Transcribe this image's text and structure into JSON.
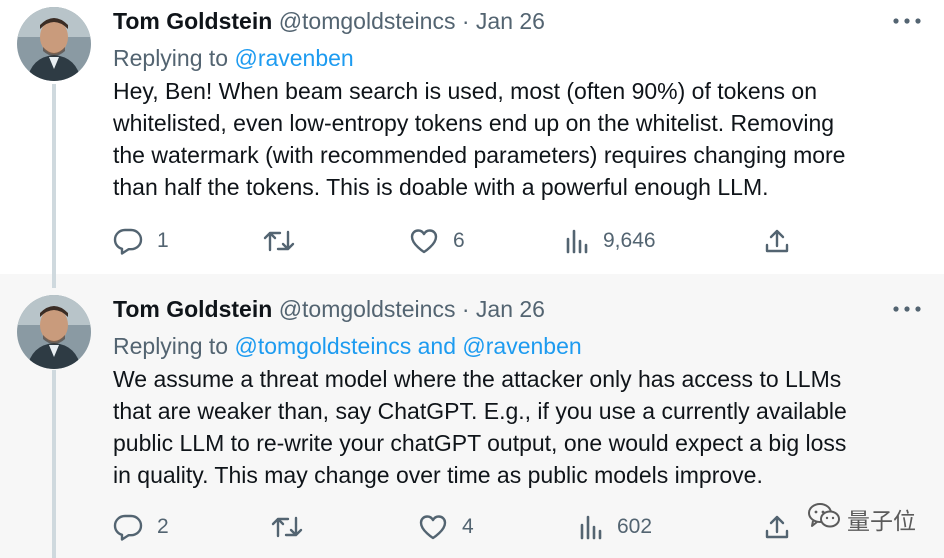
{
  "tweets": [
    {
      "author": {
        "name": "Tom Goldstein",
        "handle": "@tomgoldsteincs",
        "separator": "·",
        "date": "Jan 26"
      },
      "replying_prefix": "Replying to ",
      "mentions": [
        "@ravenben"
      ],
      "mention_joiner": "",
      "text": "Hey, Ben! When beam search is used, most (often 90%) of tokens on\nwhitelisted, even low-entropy tokens end up on the whitelist.  Removing\nthe watermark (with recommended parameters) requires changing more\nthan half the tokens.  This is doable with a powerful enough LLM.",
      "stats": {
        "replies": "1",
        "retweets": "",
        "likes": "6",
        "views": "9,646"
      }
    },
    {
      "author": {
        "name": "Tom Goldstein",
        "handle": "@tomgoldsteincs",
        "separator": "·",
        "date": "Jan 26"
      },
      "replying_prefix": "Replying to ",
      "mentions": [
        "@tomgoldsteincs",
        "@ravenben"
      ],
      "mention_joiner": " and ",
      "text": "We assume a threat model where the attacker only has access to LLMs\nthat are weaker than, say ChatGPT.  E.g., if you use a currently available\npublic LLM to re-write your chatGPT output, one would expect a big loss\nin quality. This may change over time as public models improve.",
      "stats": {
        "replies": "2",
        "retweets": "",
        "likes": "4",
        "views": "602"
      }
    }
  ],
  "watermark": {
    "text": "量子位",
    "icon": "wechat-icon"
  },
  "colors": {
    "text": "#0f1419",
    "muted": "#536471",
    "link": "#1d9bf0",
    "thread_line": "#cfd9de",
    "selected_bg": "#f7f7f7"
  },
  "icons": [
    "more-icon",
    "reply-icon",
    "retweet-icon",
    "like-icon",
    "views-icon",
    "share-icon"
  ]
}
